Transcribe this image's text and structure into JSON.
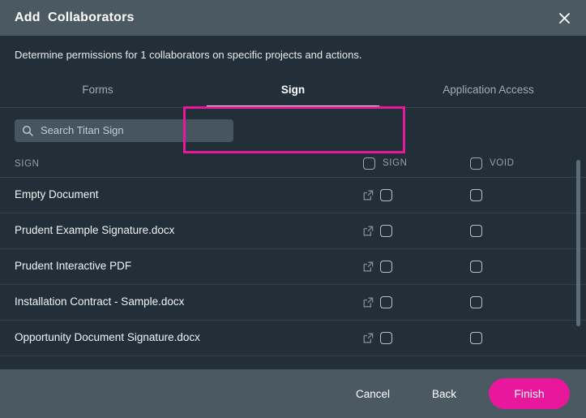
{
  "window": {
    "title": "Add  Collaborators",
    "close_icon": "close-icon"
  },
  "subtitle": "Determine permissions for 1 collaborators on specific projects and actions.",
  "tabs": [
    {
      "label": "Forms",
      "active": false
    },
    {
      "label": "Sign",
      "active": true
    },
    {
      "label": "Application Access",
      "active": false
    }
  ],
  "highlight": {
    "color": "#e8179c",
    "target_tab": "Sign"
  },
  "search": {
    "placeholder": "Search Titan Sign",
    "value": "",
    "icon": "search-icon"
  },
  "table": {
    "columns": [
      {
        "key": "name",
        "label": "SIGN",
        "has_checkbox": false
      },
      {
        "key": "sign",
        "label": "SIGN",
        "has_checkbox": true
      },
      {
        "key": "void",
        "label": "VOID",
        "has_checkbox": true
      }
    ],
    "rows": [
      {
        "name": "Empty Document",
        "sign": false,
        "void": false,
        "open_icon": "external-link-icon"
      },
      {
        "name": "Prudent Example Signature.docx",
        "sign": false,
        "void": false,
        "open_icon": "external-link-icon"
      },
      {
        "name": "Prudent Interactive PDF",
        "sign": false,
        "void": false,
        "open_icon": "external-link-icon"
      },
      {
        "name": "Installation Contract - Sample.docx",
        "sign": false,
        "void": false,
        "open_icon": "external-link-icon"
      },
      {
        "name": "Opportunity Document Signature.docx",
        "sign": false,
        "void": false,
        "open_icon": "external-link-icon"
      }
    ]
  },
  "footer": {
    "cancel_label": "Cancel",
    "back_label": "Back",
    "finish_label": "Finish",
    "finish_color": "#e8179c"
  },
  "colors": {
    "header_bg": "#4b5963",
    "body_bg": "#232f38",
    "accent": "#e8179c"
  }
}
